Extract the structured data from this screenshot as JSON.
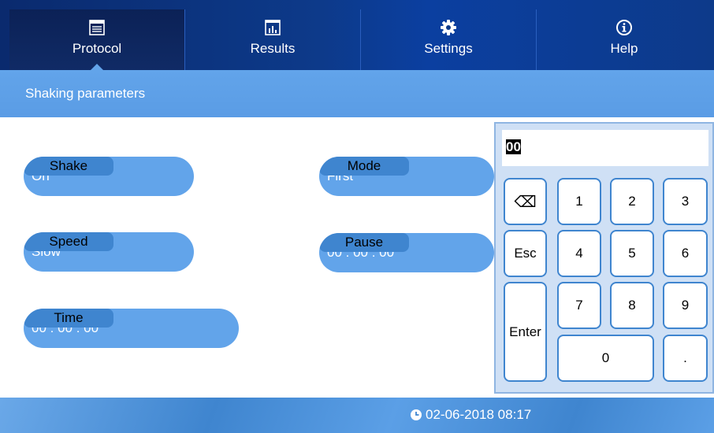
{
  "nav": {
    "tabs": [
      {
        "label": "Protocol",
        "icon": "protocol-icon"
      },
      {
        "label": "Results",
        "icon": "results-icon"
      },
      {
        "label": "Settings",
        "icon": "gear-icon"
      },
      {
        "label": "Help",
        "icon": "info-icon"
      }
    ],
    "active_tab": "Protocol"
  },
  "subheader": {
    "title": "Shaking parameters"
  },
  "fields": {
    "shake": {
      "label": "Shake",
      "value": "On"
    },
    "speed": {
      "label": "Speed",
      "value": "Slow"
    },
    "time": {
      "label": "Time",
      "value": "00 : 00 : 00"
    },
    "mode": {
      "label": "Mode",
      "value": "First"
    },
    "pause": {
      "label": "Pause",
      "value": "00 : 00 : 00"
    }
  },
  "keypad": {
    "display_value": "00",
    "keys": {
      "backspace": "⌫",
      "esc": "Esc",
      "enter": "Enter",
      "k1": "1",
      "k2": "2",
      "k3": "3",
      "k4": "4",
      "k5": "5",
      "k6": "6",
      "k7": "7",
      "k8": "8",
      "k9": "9",
      "k0": "0",
      "dot": "."
    }
  },
  "footer": {
    "datetime": "02-06-2018 08:17",
    "icon": "clock-icon"
  },
  "colors": {
    "nav_bg": "#0d3a8a",
    "accent": "#62a4ea",
    "pill_key": "#3f85cf",
    "keypad_bg": "#cfe0f5"
  }
}
